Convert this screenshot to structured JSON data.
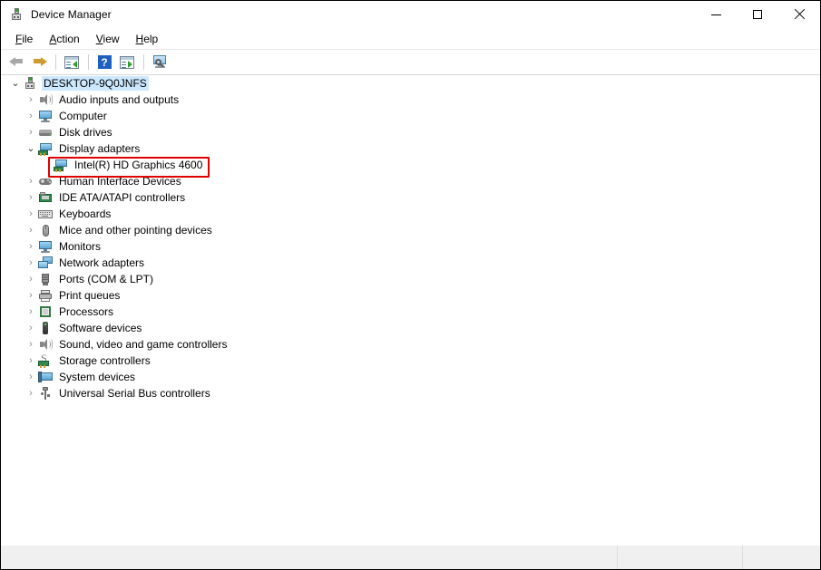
{
  "window": {
    "title": "Device Manager",
    "title_icon": "device-manager-icon",
    "controls": {
      "minimize": "Minimize",
      "maximize": "Maximize",
      "close": "Close"
    }
  },
  "menubar": {
    "items": [
      {
        "label": "File",
        "accel": "F",
        "rest": "ile"
      },
      {
        "label": "Action",
        "accel": "A",
        "rest": "ction"
      },
      {
        "label": "View",
        "accel": "V",
        "rest": "iew"
      },
      {
        "label": "Help",
        "accel": "H",
        "rest": "elp"
      }
    ]
  },
  "toolbar": {
    "buttons": [
      {
        "name": "back-button",
        "icon": "arrow-left-icon",
        "tooltip": "Back"
      },
      {
        "name": "forward-button",
        "icon": "arrow-right-icon",
        "tooltip": "Forward"
      },
      {
        "name": "properties-button",
        "icon": "properties-icon",
        "tooltip": "Properties"
      },
      {
        "name": "help-button",
        "icon": "help-icon",
        "tooltip": "Help"
      },
      {
        "name": "update-driver-button",
        "icon": "update-driver-icon",
        "tooltip": "Update driver"
      },
      {
        "name": "scan-hardware-button",
        "icon": "scan-monitor-icon",
        "tooltip": "Scan for hardware changes"
      }
    ]
  },
  "tree": {
    "root": {
      "label": "DESKTOP-9Q0JNFS",
      "icon": "computer-root-icon",
      "expanded": true,
      "selected": true
    },
    "nodes": [
      {
        "label": "Audio inputs and outputs",
        "icon": "speaker-icon",
        "expanded": false,
        "level": 1
      },
      {
        "label": "Computer",
        "icon": "monitor-icon",
        "expanded": false,
        "level": 1
      },
      {
        "label": "Disk drives",
        "icon": "disk-drive-icon",
        "expanded": false,
        "level": 1
      },
      {
        "label": "Display adapters",
        "icon": "display-adapter-icon",
        "expanded": true,
        "level": 1
      },
      {
        "label": "Intel(R) HD Graphics 4600",
        "icon": "display-adapter-icon",
        "expanded": null,
        "level": 2,
        "highlighted": true
      },
      {
        "label": "Human Interface Devices",
        "icon": "gamepad-icon",
        "expanded": false,
        "level": 1
      },
      {
        "label": "IDE ATA/ATAPI controllers",
        "icon": "ide-controller-icon",
        "expanded": false,
        "level": 1
      },
      {
        "label": "Keyboards",
        "icon": "keyboard-icon",
        "expanded": false,
        "level": 1
      },
      {
        "label": "Mice and other pointing devices",
        "icon": "mouse-icon",
        "expanded": false,
        "level": 1
      },
      {
        "label": "Monitors",
        "icon": "monitor-icon",
        "expanded": false,
        "level": 1
      },
      {
        "label": "Network adapters",
        "icon": "network-adapter-icon",
        "expanded": false,
        "level": 1
      },
      {
        "label": "Ports (COM & LPT)",
        "icon": "port-icon",
        "expanded": false,
        "level": 1
      },
      {
        "label": "Print queues",
        "icon": "printer-icon",
        "expanded": false,
        "level": 1
      },
      {
        "label": "Processors",
        "icon": "processor-icon",
        "expanded": false,
        "level": 1
      },
      {
        "label": "Software devices",
        "icon": "software-device-icon",
        "expanded": false,
        "level": 1
      },
      {
        "label": "Sound, video and game controllers",
        "icon": "speaker-icon",
        "expanded": false,
        "level": 1
      },
      {
        "label": "Storage controllers",
        "icon": "storage-controller-icon",
        "expanded": false,
        "level": 1
      },
      {
        "label": "System devices",
        "icon": "system-device-icon",
        "expanded": false,
        "level": 1
      },
      {
        "label": "Universal Serial Bus controllers",
        "icon": "usb-icon",
        "expanded": false,
        "level": 1
      }
    ],
    "chevron_collapsed": "›",
    "chevron_expanded": "⌄"
  },
  "annotation": {
    "highlight_color": "#e00000",
    "target_label": "Intel(R) HD Graphics 4600"
  },
  "statusbar": {
    "panes": [
      "",
      "",
      ""
    ]
  },
  "colors": {
    "selection": "#cce8ff",
    "window_bg": "#ffffff",
    "statusbar_bg": "#f0f0f0",
    "accent_red": "#e00000"
  }
}
